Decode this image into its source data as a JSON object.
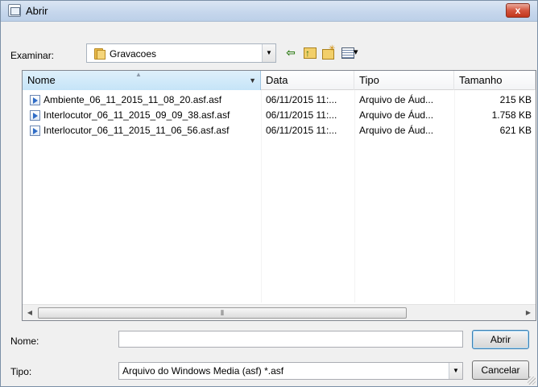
{
  "window": {
    "title": "Abrir",
    "close_label": "x"
  },
  "lookin": {
    "label": "Examinar:",
    "folder": "Gravacoes"
  },
  "columns": {
    "name": "Nome",
    "date": "Data",
    "type": "Tipo",
    "size": "Tamanho"
  },
  "files": [
    {
      "name": "Ambiente_06_11_2015_11_08_20.asf.asf",
      "date": "06/11/2015 11:...",
      "type": "Arquivo de Áud...",
      "size": "215 KB"
    },
    {
      "name": "Interlocutor_06_11_2015_09_09_38.asf.asf",
      "date": "06/11/2015 11:...",
      "type": "Arquivo de Áud...",
      "size": "1.758 KB"
    },
    {
      "name": "Interlocutor_06_11_2015_11_06_56.asf.asf",
      "date": "06/11/2015 11:...",
      "type": "Arquivo de Áud...",
      "size": "621 KB"
    }
  ],
  "filename": {
    "label": "Nome:",
    "value": ""
  },
  "filetype": {
    "label": "Tipo:",
    "value": "Arquivo do Windows Media (asf) *.asf"
  },
  "buttons": {
    "open": "Abrir",
    "cancel": "Cancelar"
  },
  "icons": {
    "title": "dialog-icon",
    "folder": "folder-icon",
    "back": "back-arrow-icon",
    "up": "up-folder-icon",
    "new_folder": "new-folder-icon",
    "views": "views-menu-icon",
    "file": "windows-media-file-icon"
  },
  "colors": {
    "header_active": "#c5e4f8",
    "close_button": "#d4553e",
    "back_arrow": "#2b7a12"
  }
}
